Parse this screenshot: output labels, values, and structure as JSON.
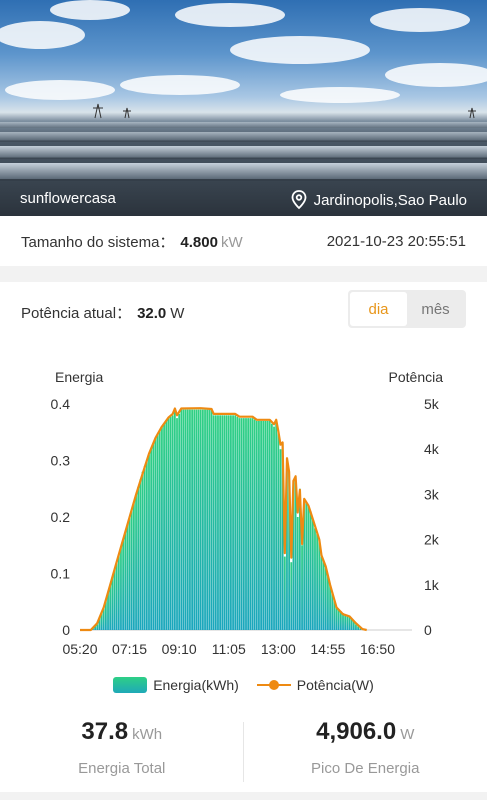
{
  "hero": {
    "owner": "sunflowercasa",
    "location": "Jardinopolis,Sao Paulo",
    "location_icon": "map-pin-icon"
  },
  "info": {
    "size_label": "Tamanho do sistema：",
    "size_value": "4.800",
    "size_unit": "kW",
    "timestamp": "2021-10-23 20:55:51"
  },
  "power": {
    "label": "Potência atual：",
    "value": "32.0",
    "unit": "W"
  },
  "toggle": {
    "day": "dia",
    "month": "mês",
    "selected": "dia"
  },
  "chart_data": {
    "type": "area",
    "left_axis_label": "Energia",
    "right_axis_label": "Potência",
    "left_ticks": [
      "0.4",
      "0.3",
      "0.2",
      "0.1",
      "0"
    ],
    "right_ticks": [
      "5k",
      "4k",
      "3k",
      "2k",
      "1k",
      "0"
    ],
    "x_ticks": [
      "05:20",
      "07:15",
      "09:10",
      "11:05",
      "13:00",
      "14:55",
      "16:50"
    ],
    "ylim_left": [
      0,
      0.4
    ],
    "ylim_right": [
      0,
      5000
    ],
    "x_minutes_start": 320,
    "x_minutes_end": 1090,
    "energy_color": "#2ecf86",
    "power_color": "#ee8a12",
    "series": [
      {
        "name": "Energia(kWh)",
        "points": [
          [
            320,
            0
          ],
          [
            345,
            0
          ],
          [
            360,
            0.01
          ],
          [
            375,
            0.04
          ],
          [
            390,
            0.08
          ],
          [
            405,
            0.12
          ],
          [
            420,
            0.16
          ],
          [
            435,
            0.2
          ],
          [
            450,
            0.24
          ],
          [
            465,
            0.28
          ],
          [
            480,
            0.31
          ],
          [
            495,
            0.34
          ],
          [
            510,
            0.36
          ],
          [
            525,
            0.375
          ],
          [
            535,
            0.38
          ],
          [
            540,
            0.39
          ],
          [
            545,
            0.375
          ],
          [
            555,
            0.39
          ],
          [
            600,
            0.39
          ],
          [
            625,
            0.39
          ],
          [
            630,
            0.38
          ],
          [
            680,
            0.38
          ],
          [
            690,
            0.375
          ],
          [
            720,
            0.375
          ],
          [
            730,
            0.37
          ],
          [
            760,
            0.37
          ],
          [
            770,
            0.36
          ],
          [
            775,
            0.37
          ],
          [
            780,
            0.35
          ],
          [
            785,
            0.32
          ],
          [
            790,
            0.33
          ],
          [
            795,
            0.13
          ],
          [
            800,
            0.3
          ],
          [
            805,
            0.28
          ],
          [
            810,
            0.12
          ],
          [
            815,
            0.26
          ],
          [
            820,
            0.27
          ],
          [
            825,
            0.2
          ],
          [
            830,
            0.25
          ],
          [
            835,
            0.15
          ],
          [
            840,
            0.23
          ],
          [
            850,
            0.22
          ],
          [
            855,
            0.21
          ],
          [
            865,
            0.18
          ],
          [
            875,
            0.16
          ],
          [
            880,
            0.13
          ],
          [
            890,
            0.11
          ],
          [
            900,
            0.08
          ],
          [
            915,
            0.04
          ],
          [
            930,
            0.03
          ],
          [
            945,
            0.025
          ],
          [
            960,
            0.01
          ],
          [
            975,
            0.0
          ],
          [
            985,
            0
          ]
        ]
      },
      {
        "name": "Potência(W)",
        "points": [
          [
            320,
            0
          ],
          [
            345,
            0
          ],
          [
            360,
            150
          ],
          [
            375,
            500
          ],
          [
            390,
            1000
          ],
          [
            405,
            1500
          ],
          [
            420,
            2000
          ],
          [
            435,
            2500
          ],
          [
            450,
            3000
          ],
          [
            465,
            3450
          ],
          [
            480,
            3900
          ],
          [
            495,
            4250
          ],
          [
            510,
            4500
          ],
          [
            525,
            4700
          ],
          [
            535,
            4780
          ],
          [
            540,
            4900
          ],
          [
            545,
            4750
          ],
          [
            555,
            4900
          ],
          [
            600,
            4906
          ],
          [
            625,
            4890
          ],
          [
            630,
            4780
          ],
          [
            680,
            4780
          ],
          [
            690,
            4720
          ],
          [
            720,
            4720
          ],
          [
            730,
            4650
          ],
          [
            760,
            4650
          ],
          [
            770,
            4550
          ],
          [
            775,
            4650
          ],
          [
            780,
            4400
          ],
          [
            785,
            4100
          ],
          [
            790,
            4150
          ],
          [
            795,
            1700
          ],
          [
            800,
            3800
          ],
          [
            805,
            3500
          ],
          [
            810,
            1600
          ],
          [
            815,
            3300
          ],
          [
            820,
            3400
          ],
          [
            825,
            2600
          ],
          [
            830,
            3100
          ],
          [
            835,
            1900
          ],
          [
            840,
            2900
          ],
          [
            850,
            2750
          ],
          [
            855,
            2600
          ],
          [
            865,
            2300
          ],
          [
            875,
            2000
          ],
          [
            880,
            1650
          ],
          [
            890,
            1400
          ],
          [
            900,
            1000
          ],
          [
            915,
            500
          ],
          [
            930,
            350
          ],
          [
            945,
            300
          ],
          [
            960,
            150
          ],
          [
            975,
            20
          ],
          [
            985,
            0
          ]
        ]
      }
    ]
  },
  "stats": {
    "total_value": "37.8",
    "total_unit": "kWh",
    "total_label": "Energia Total",
    "peak_value": "4,906.0",
    "peak_unit": "W",
    "peak_label": "Pico De Energia"
  }
}
